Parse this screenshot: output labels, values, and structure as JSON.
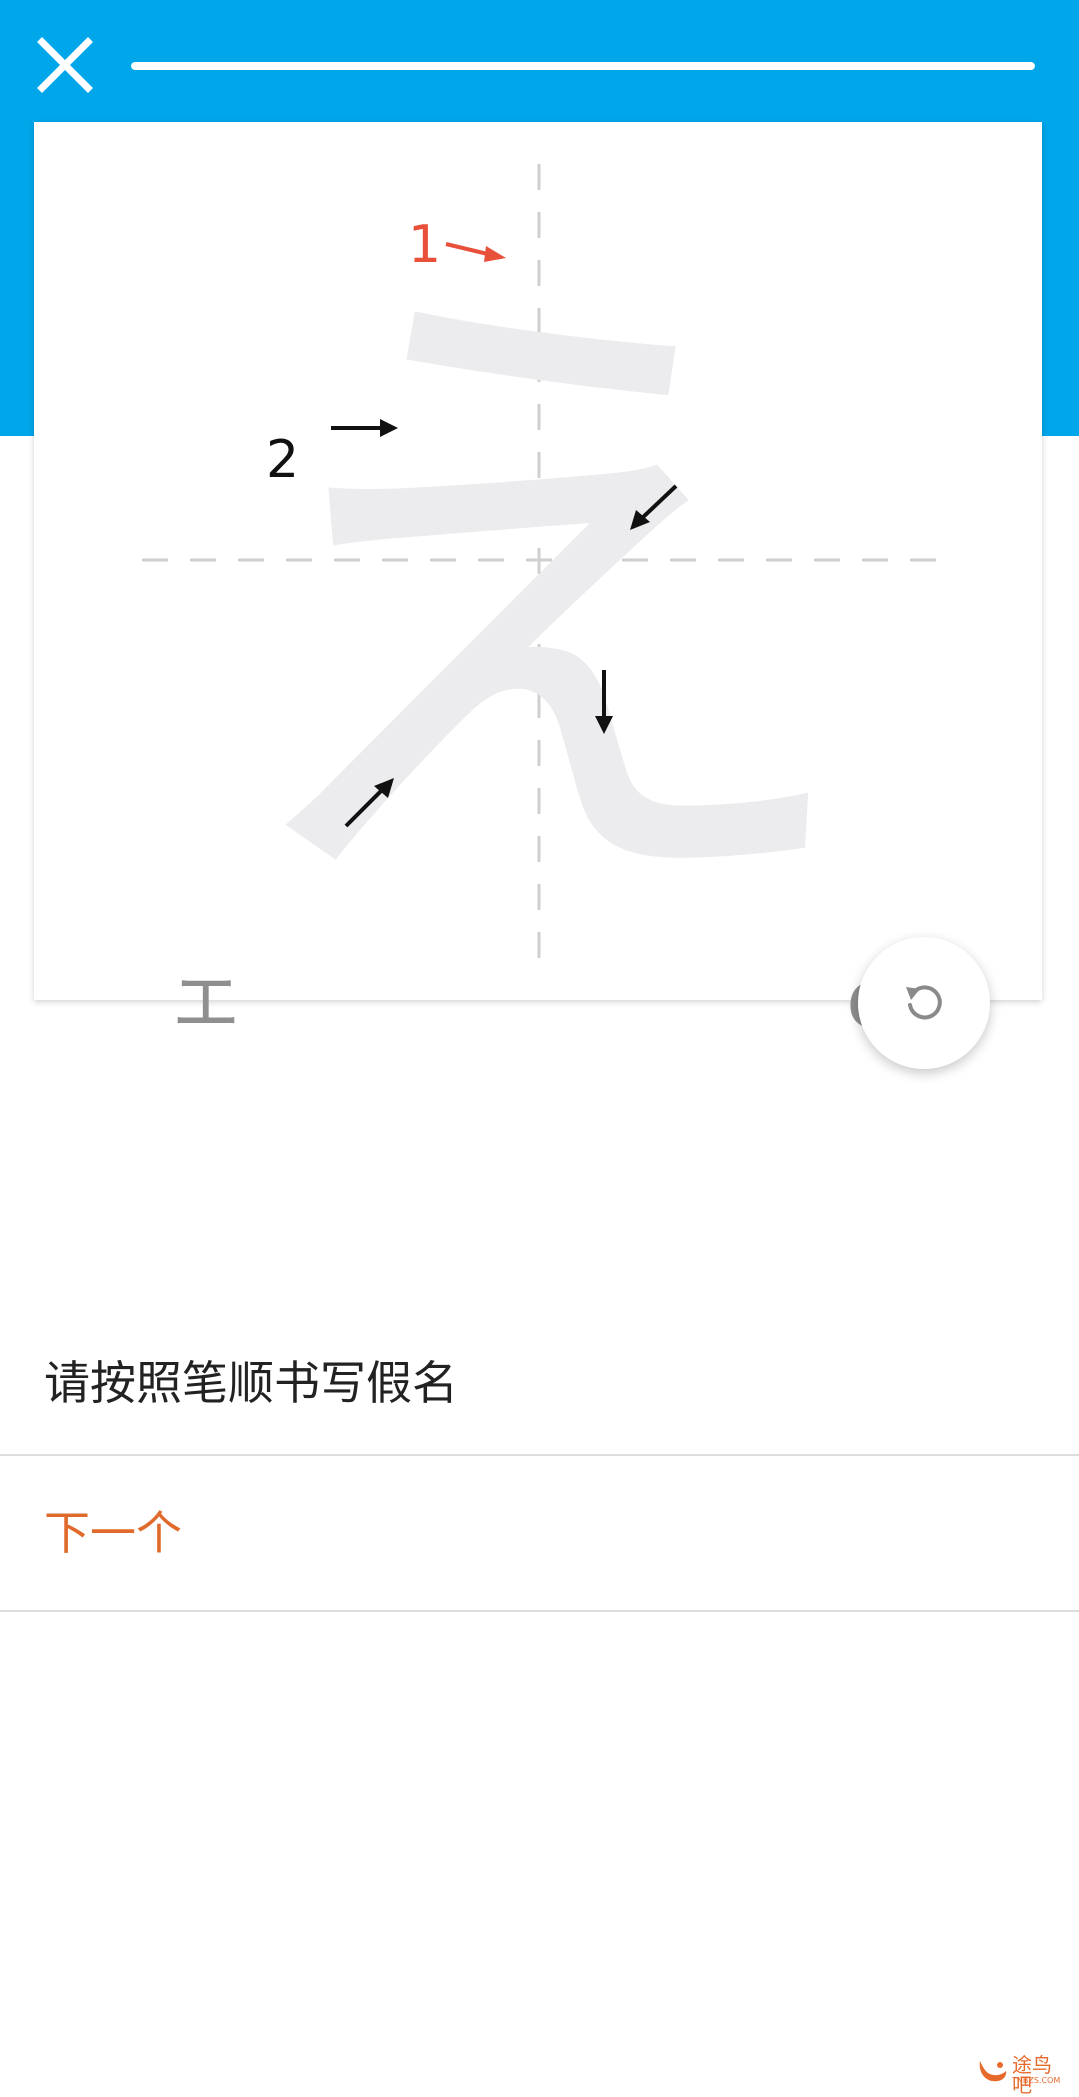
{
  "app": {
    "header_color": "#00a6ea",
    "accent_color": "#e06a2c"
  },
  "header": {
    "close_icon": "close-icon",
    "progress": 1.0
  },
  "practice_card": {
    "kana": "え",
    "kana_hint": "エ",
    "romaji": "e",
    "stroke_numbers": [
      "1",
      "2"
    ],
    "stroke_1_color": "#e8503a"
  },
  "controls": {
    "reset_icon": "undo-icon"
  },
  "instruction": {
    "text": "请按照笔顺书写假名"
  },
  "actions": {
    "next_label": "下一个"
  },
  "watermark": {
    "text": "途鸟吧",
    "sub": "TNBZS.COM"
  }
}
